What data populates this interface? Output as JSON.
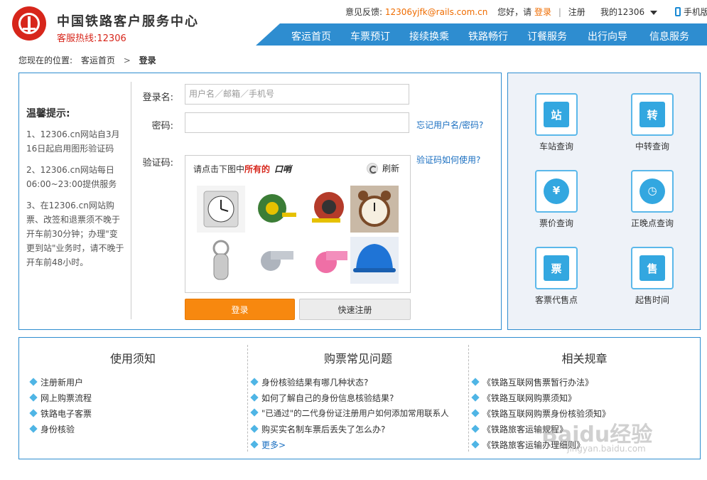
{
  "header": {
    "site_title": "中国铁路客户服务中心",
    "hotline": "客服热线:12306",
    "feedback_label": "意见反馈:",
    "feedback_email": "12306yjfk@rails.com.cn",
    "greeting": "您好，请",
    "login_link": "登录",
    "register_link": "注册",
    "my12306": "我的12306",
    "mobile": "手机版"
  },
  "nav": {
    "items": [
      "客运首页",
      "车票预订",
      "接续换乘",
      "铁路畅行",
      "订餐服务",
      "出行向导",
      "信息服务"
    ]
  },
  "breadcrumb": {
    "prefix": "您现在的位置:",
    "home": "客运首页",
    "sep": ">",
    "current": "登录"
  },
  "tips": {
    "title": "温馨提示:",
    "items": [
      "1、12306.cn网站自3月16日起启用图形验证码",
      "2、12306.cn网站每日06:00~23:00提供服务",
      "3、在12306.cn网站购票、改签和退票须不晚于开车前30分钟；办理\"变更到站\"业务时，请不晚于开车前48小时。"
    ]
  },
  "form": {
    "username_label": "登录名:",
    "username_placeholder": "用户名／邮箱／手机号",
    "password_label": "密码:",
    "forgot_link": "忘记用户名/密码?",
    "captcha_label": "验证码:",
    "captcha_help": "验证码如何使用?",
    "captcha_prompt_prefix": "请点击下图中",
    "captcha_prompt_red": "所有的",
    "captcha_word": "口哨",
    "captcha_refresh": "刷新",
    "login_button": "登录",
    "quick_register_button": "快速注册"
  },
  "captcha_images": [
    {
      "name": "clock",
      "color": "#e6e6e6"
    },
    {
      "name": "tape-measure",
      "color": "#3b7d36"
    },
    {
      "name": "tape-measure",
      "color": "#b43b2a"
    },
    {
      "name": "alarm-clock",
      "color": "#7a4a28"
    },
    {
      "name": "bottle-opener",
      "color": "#c9c9c9"
    },
    {
      "name": "whistle",
      "color": "#aeb4bd"
    },
    {
      "name": "whistle",
      "color": "#ef6fa6"
    },
    {
      "name": "hard-hat",
      "color": "#1f74d6"
    }
  ],
  "services": [
    {
      "label": "车站查询",
      "glyph": "站"
    },
    {
      "label": "中转查询",
      "glyph": "转"
    },
    {
      "label": "票价查询",
      "glyph": "¥"
    },
    {
      "label": "正晚点查询",
      "glyph": "◷"
    },
    {
      "label": "客票代售点",
      "glyph": "票"
    },
    {
      "label": "起售时间",
      "glyph": "售"
    }
  ],
  "info": {
    "col1": {
      "title": "使用须知",
      "items": [
        "注册新用户",
        "网上购票流程",
        "铁路电子客票",
        "身份核验"
      ]
    },
    "col2": {
      "title": "购票常见问题",
      "items": [
        "身份核验结果有哪几种状态?",
        "如何了解自己的身份信息核验结果?",
        "\"已通过\"的二代身份证注册用户如何添加常用联系人",
        "购买实名制车票后丢失了怎么办?"
      ],
      "more": "更多>"
    },
    "col3": {
      "title": "相关规章",
      "items": [
        "《铁路互联网售票暂行办法》",
        "《铁路互联网购票须知》",
        "《铁路互联网购票身份核验须知》",
        "《铁路旅客运输规程》",
        "《铁路旅客运输办理细则》"
      ]
    }
  },
  "watermark": {
    "main": "Baidu经验",
    "sub": "jingyan.baidu.com"
  }
}
